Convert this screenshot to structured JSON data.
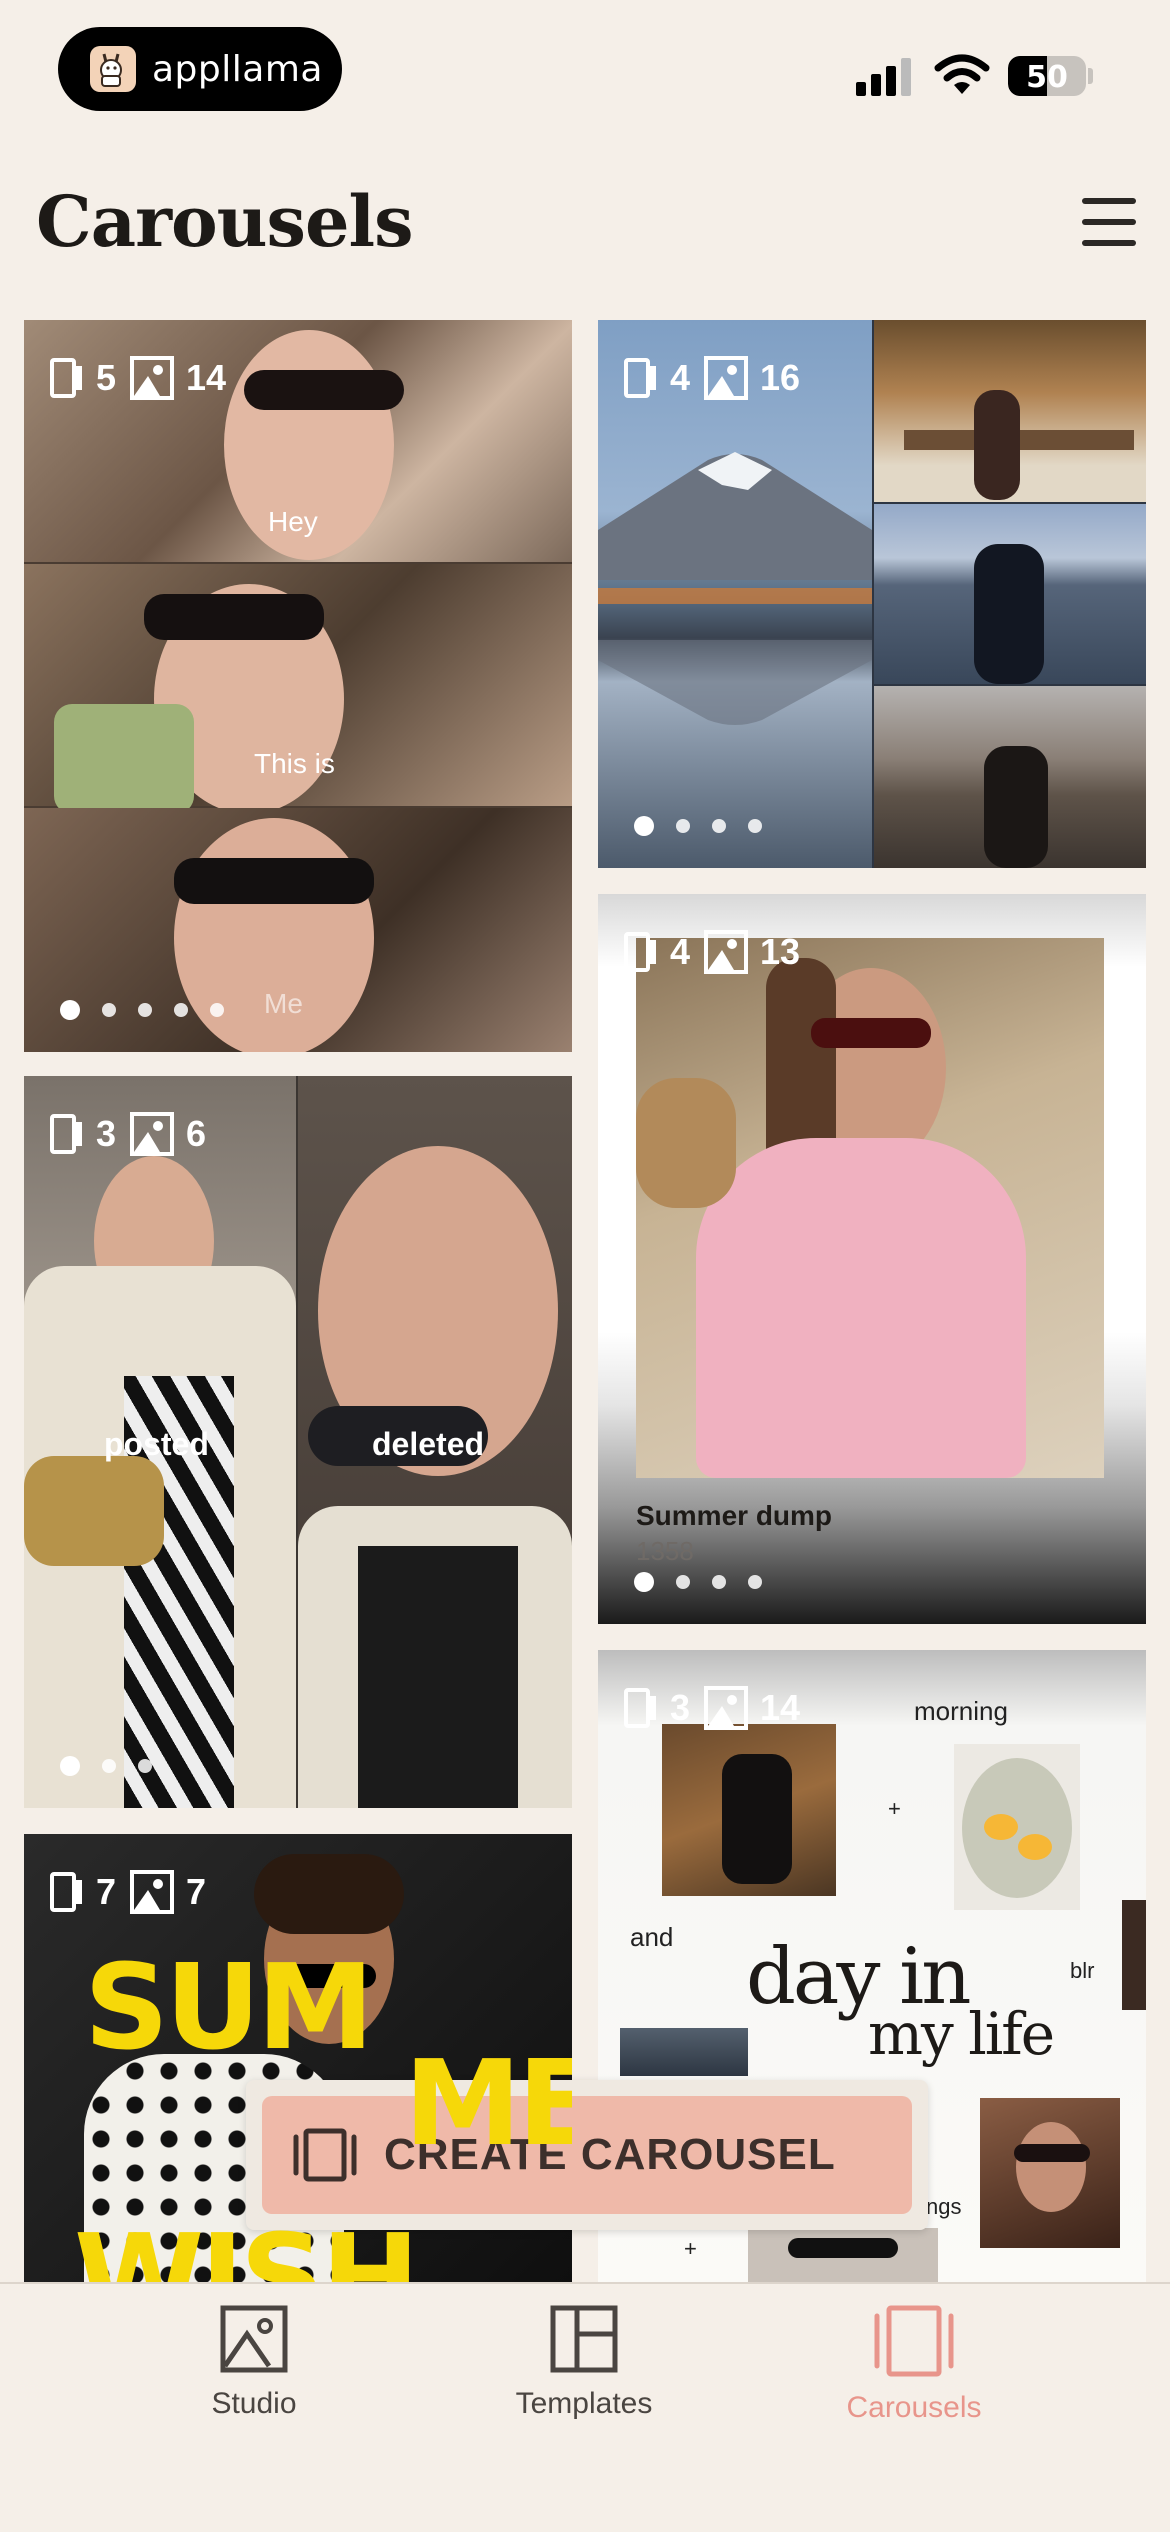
{
  "status_bar": {
    "app_name": "appllama",
    "battery_level": 50,
    "battery_label": "50"
  },
  "header": {
    "title": "Carousels"
  },
  "cards": [
    {
      "id": "selfie",
      "slides": "5",
      "images": "14",
      "dots": 5,
      "active_dot": 0,
      "texts": [
        "Hey",
        "This is",
        "Me"
      ]
    },
    {
      "id": "fuji",
      "slides": "4",
      "images": "16",
      "dots": 4,
      "active_dot": 0
    },
    {
      "id": "posted",
      "slides": "3",
      "images": "6",
      "dots": 3,
      "active_dot": 0,
      "texts": [
        "posted",
        "deleted"
      ]
    },
    {
      "id": "summer",
      "slides": "4",
      "images": "13",
      "dots": 4,
      "active_dot": 0,
      "title": "Summer dump",
      "subtitle": "1358"
    },
    {
      "id": "dayinlife",
      "slides": "3",
      "images": "14",
      "texts": [
        "morning",
        "+",
        "and",
        "day in",
        "my life",
        "blr",
        "+",
        "ngs"
      ]
    },
    {
      "id": "sum",
      "slides": "7",
      "images": "7",
      "texts": [
        "SUM",
        "MER",
        "WISH"
      ]
    }
  ],
  "cta": {
    "label": "CREATE CAROUSEL"
  },
  "nav": {
    "items": [
      {
        "label": "Studio",
        "active": false
      },
      {
        "label": "Templates",
        "active": false
      },
      {
        "label": "Carousels",
        "active": true
      }
    ],
    "active_color": "#e8958b",
    "inactive_color": "#4a4541"
  }
}
